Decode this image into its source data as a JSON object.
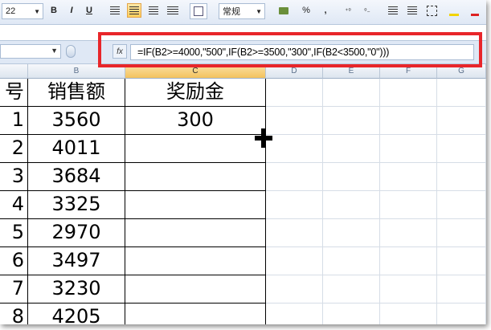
{
  "toolbar": {
    "font_size": "22",
    "bold_label": "B",
    "italic_label": "I",
    "underline_label": "U",
    "number_format": "常规",
    "percent_label": "%",
    "comma_label": ","
  },
  "formula_bar": {
    "fx_label": "fx",
    "formula": "=IF(B2>=4000,\"500\",IF(B2>=3500,\"300\",IF(B2<3500,\"0\")))"
  },
  "columns": [
    {
      "label": ""
    },
    {
      "label": "B"
    },
    {
      "label": "C"
    },
    {
      "label": "D"
    },
    {
      "label": "E"
    },
    {
      "label": "F"
    },
    {
      "label": "G"
    }
  ],
  "table": {
    "headers": [
      "号",
      "销售额",
      "奖励金"
    ],
    "rows": [
      {
        "a": "1",
        "b": "3560",
        "c": "300"
      },
      {
        "a": "2",
        "b": "4011",
        "c": ""
      },
      {
        "a": "3",
        "b": "3684",
        "c": ""
      },
      {
        "a": "4",
        "b": "3325",
        "c": ""
      },
      {
        "a": "5",
        "b": "2970",
        "c": ""
      },
      {
        "a": "6",
        "b": "3497",
        "c": ""
      },
      {
        "a": "7",
        "b": "3230",
        "c": ""
      },
      {
        "a": "8",
        "b": "4205",
        "c": ""
      }
    ]
  },
  "colors": {
    "highlight_border": "#e8262a",
    "selected_column_header": "#f3c25e"
  },
  "icons": [
    "bold-icon",
    "italic-icon",
    "underline-icon",
    "align-left-icon",
    "align-center-icon",
    "align-right-icon",
    "merge-icon",
    "currency-icon",
    "percent-icon",
    "increase-decimal-icon",
    "decrease-decimal-icon",
    "indent-icon",
    "borders-icon",
    "fx-icon",
    "crosshair-cursor-icon"
  ]
}
